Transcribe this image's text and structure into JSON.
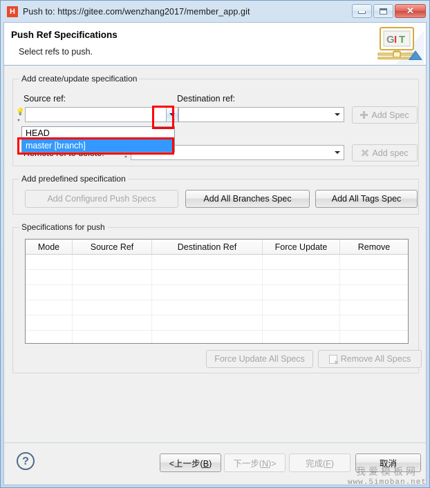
{
  "window": {
    "title": "Push to: https://gitee.com/wenzhang2017/member_app.git",
    "app_icon": "h-icon",
    "controls": {
      "minimize": "minimize-icon",
      "maximize": "maximize-icon",
      "close": "✕"
    }
  },
  "header": {
    "title": "Push Ref Specifications",
    "subtitle": "Select refs to push.",
    "logo_g": "G",
    "logo_i": "I",
    "logo_t": "T"
  },
  "create_update": {
    "group_label": "Add create/update specification",
    "source_ref_label": "Source ref:",
    "destination_ref_label": "Destination ref:",
    "source_ref_value": "",
    "destination_ref_value": "",
    "add_spec_label": "Add Spec",
    "dropdown": {
      "open": true,
      "items": [
        {
          "label": "HEAD",
          "selected": false
        },
        {
          "label": "master [branch]",
          "selected": true
        }
      ]
    }
  },
  "delete_spec": {
    "remote_ref_label": "Remote ref to delete:",
    "remote_ref_value": "",
    "add_spec_label": "Add spec"
  },
  "predefined": {
    "group_label": "Add predefined specification",
    "configured_push_specs": "Add Configured Push Specs",
    "all_branches_spec": "Add All Branches Spec",
    "all_tags_spec": "Add All Tags Spec"
  },
  "specifications": {
    "group_label": "Specifications for push",
    "columns": [
      "Mode",
      "Source Ref",
      "Destination Ref",
      "Force Update",
      "Remove"
    ],
    "rows": [],
    "empty_row_count": 7,
    "force_update_all": "Force Update All Specs",
    "remove_all": "Remove All Specs"
  },
  "footer": {
    "help": "?",
    "back": "<上一步(B)",
    "back_plain": "上一步",
    "next": "下一步(N)>",
    "finish": "完成(F)",
    "cancel": "取消"
  },
  "watermark": {
    "cn": "我爱模板网",
    "en": "www.5imoban.net"
  },
  "colors": {
    "selection_blue": "#3399ff",
    "annotation_red": "#ff0000",
    "title_icon_red": "#e8492e",
    "window_chrome": "#cbdcee"
  }
}
